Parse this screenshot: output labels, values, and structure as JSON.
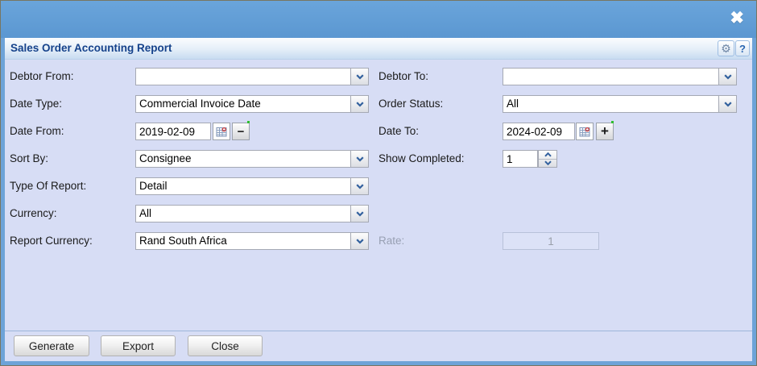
{
  "window": {
    "icons": {
      "close": "✖",
      "gear": "⚙",
      "help": "?",
      "minus": "−",
      "plus": "+"
    }
  },
  "header": {
    "title": "Sales Order Accounting Report"
  },
  "form": {
    "debtor_from": {
      "label": "Debtor From:",
      "value": ""
    },
    "debtor_to": {
      "label": "Debtor To:",
      "value": ""
    },
    "date_type": {
      "label": "Date Type:",
      "value": "Commercial Invoice Date"
    },
    "order_status": {
      "label": "Order Status:",
      "value": "All"
    },
    "date_from": {
      "label": "Date From:",
      "value": "2019-02-09"
    },
    "date_to": {
      "label": "Date To:",
      "value": "2024-02-09"
    },
    "sort_by": {
      "label": "Sort By:",
      "value": "Consignee"
    },
    "show_completed": {
      "label": "Show Completed:",
      "value": "1"
    },
    "type_of_report": {
      "label": "Type Of Report:",
      "value": "Detail"
    },
    "currency": {
      "label": "Currency:",
      "value": "All"
    },
    "report_currency": {
      "label": "Report Currency:",
      "value": "Rand South Africa"
    },
    "rate": {
      "label": "Rate:",
      "value": "1",
      "disabled": true
    }
  },
  "footer": {
    "generate": "Generate",
    "export": "Export",
    "close": "Close"
  },
  "colors": {
    "titlebar": "#5d9bd3",
    "frame": "#6da3d8",
    "body": "#d7ddf5",
    "header_text": "#15428b",
    "chevron": "#33619e",
    "calendar_dot": "#d03b3b",
    "dirty_dot": "#2fbe2f"
  }
}
